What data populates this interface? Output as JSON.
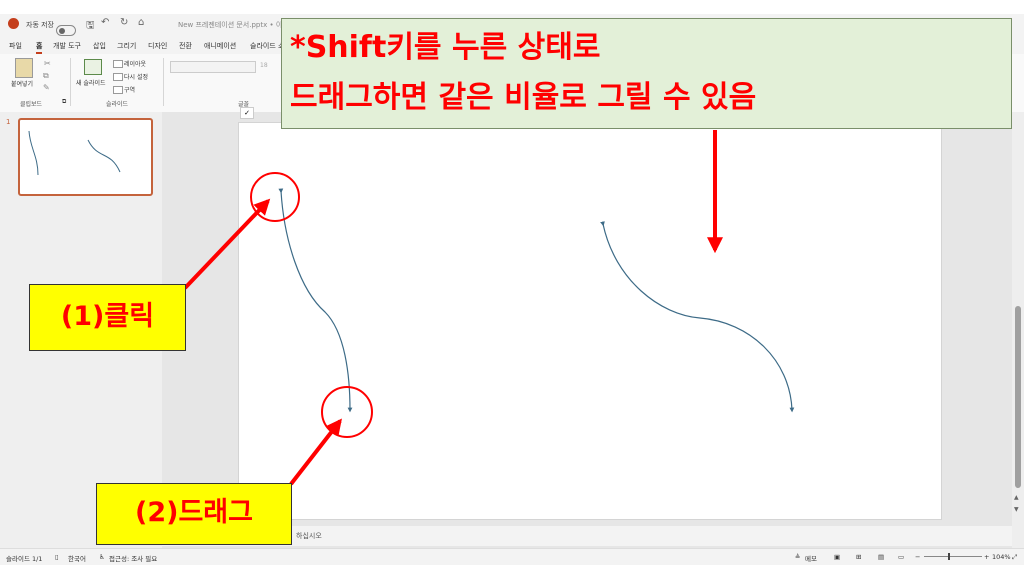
{
  "titlebar": {
    "autosave_label": "자동 저장",
    "doc_title": "New 프레젠테이션 문서.pptx • 이 PC"
  },
  "menu": [
    "파일",
    "홈",
    "개발 도구",
    "삽입",
    "그리기",
    "디자인",
    "전환",
    "애니메이션",
    "슬라이드 쇼"
  ],
  "ribbon": {
    "paste_label": "붙여넣기",
    "clipboard_group": "클립보드",
    "new_slide_label": "새 슬라이드",
    "layout_label": "레이아웃",
    "reset_label": "다시 설정",
    "section_label": "구역",
    "slides_group": "슬라이드",
    "font_group": "글꼴",
    "font_size": "18"
  },
  "thumbnails": [
    {
      "number": "1"
    }
  ],
  "notes_placeholder": "하십시오",
  "statusbar": {
    "slide_counter": "슬라이드 1/1",
    "language": "한국어",
    "accessibility": "접근성: 조사 필요",
    "notes_button": "메모",
    "zoom": "104%"
  },
  "annotations": {
    "callout_line1": "*Shift키를 누른 상태로",
    "callout_line2": "드래그하면 같은 비율로 그릴 수 있음",
    "step1": "(1)클릭",
    "step2": "(2)드래그"
  },
  "colors": {
    "accent": "#c4633c",
    "annotation_red": "#ff0000",
    "highlight_yellow": "#ffff00",
    "callout_green": "#e3f0d8",
    "curve_stroke": "#3d6b87"
  }
}
